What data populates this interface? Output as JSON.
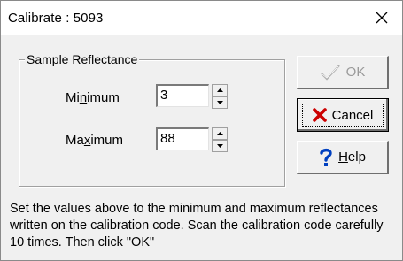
{
  "window": {
    "title": "Calibrate : 5093",
    "close_icon": "close-icon"
  },
  "group": {
    "legend": "Sample Reflectance"
  },
  "fields": {
    "minimum": {
      "label_before": "Mi",
      "label_mnemonic": "n",
      "label_after": "imum",
      "value": "3"
    },
    "maximum": {
      "label_before": "Ma",
      "label_mnemonic": "x",
      "label_after": "imum",
      "value": "88"
    }
  },
  "buttons": {
    "ok": {
      "label": "OK",
      "icon": "checkmark-icon",
      "enabled": false
    },
    "cancel": {
      "label": "Cancel",
      "icon": "red-x-icon",
      "default": true
    },
    "help": {
      "label_mnemonic": "H",
      "label_after": "elp",
      "icon": "question-mark-icon"
    }
  },
  "instructions": "Set the values above to the minimum and maximum reflectances written on the calibration code. Scan the calibration code carefully 10 times. Then click \"OK\"",
  "colors": {
    "window_bg": "#f0f0f0",
    "titlebar_bg": "#ffffff",
    "cancel_x": "#cc0000",
    "help_q": "#0040c0",
    "disabled_text": "#9a9a9a"
  }
}
